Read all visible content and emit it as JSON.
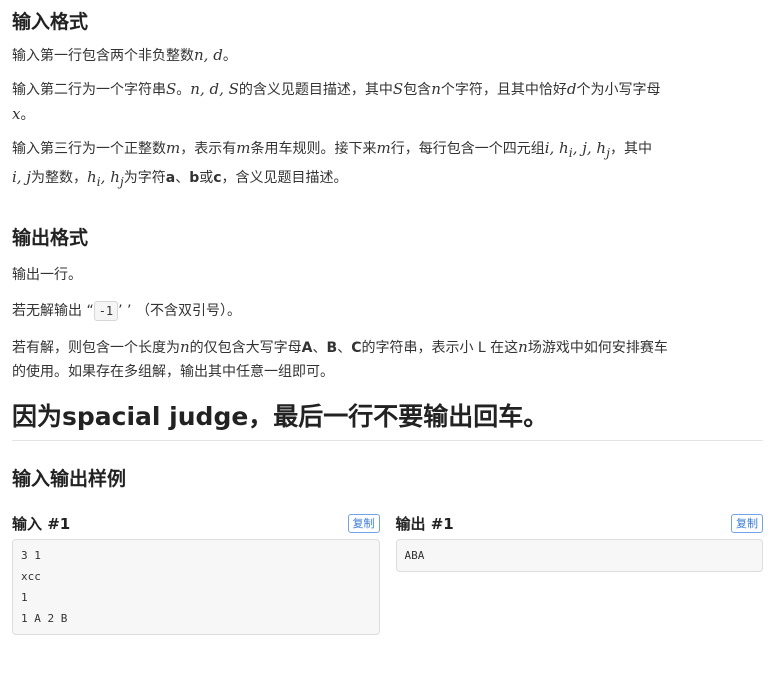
{
  "input_format": {
    "title": "输入格式",
    "line1": {
      "t1": "输入第一行包含两个非负整数",
      "m1": "n, d",
      "t2": "。"
    },
    "line2": {
      "t1": "输入第二行为一个字符串",
      "m1": "S",
      "t2": "。",
      "m2": "n, d, S",
      "t3": "的含义见题目描述，其中",
      "m3": "S",
      "t4": "包含",
      "m4": "n",
      "t5": "个字符，且其中恰好",
      "m5": "d",
      "t6": "个为小写字母",
      "m6": "x",
      "t7": "。"
    },
    "line3": {
      "t1": "输入第三行为一个正整数",
      "m1": "m",
      "t2": "，表示有",
      "m2": "m",
      "t3": "条用车规则。接下来",
      "m3": "m",
      "t4": "行，每行包含一个四元组",
      "m4": "i, h",
      "m4s": "i",
      "m4b": ", j, h",
      "m4s2": "j",
      "t5": "，其中",
      "m5": "i, j",
      "t6": "为整数，",
      "m6": "h",
      "m6s": "i",
      "m6b": ", h",
      "m6s2": "j",
      "t7": "为字符",
      "b1": "a",
      "t8": "、",
      "b2": "b",
      "t9": "或",
      "b3": "c",
      "t10": "，含义见题目描述。"
    }
  },
  "output_format": {
    "title": "输出格式",
    "line1": "输出一行。",
    "line2": {
      "t1": "若无解输出 “",
      "code": "-1",
      "t2": "’ ’ （不含双引号）。"
    },
    "line3": {
      "t1": "若有解，则包含一个长度为",
      "m1": "n",
      "t2": "的仅包含大写字母",
      "b1": "A",
      "t3": "、",
      "b2": "B",
      "t4": "、",
      "b3": "C",
      "t5": "的字符串，表示小 L 在这",
      "m2": "n",
      "t6": "场游戏中如何安排赛车",
      "t7": "的使用。如果存在多组解，输出其中任意一组即可。"
    }
  },
  "notice": "因为spacial judge，最后一行不要输出回车。",
  "samples": {
    "title": "输入输出样例",
    "input": {
      "label": "输入 #1",
      "copy": "复制",
      "content": "3 1\nxcc\n1\n1 A 2 B"
    },
    "output": {
      "label": "输出 #1",
      "copy": "复制",
      "content": "ABA"
    }
  }
}
